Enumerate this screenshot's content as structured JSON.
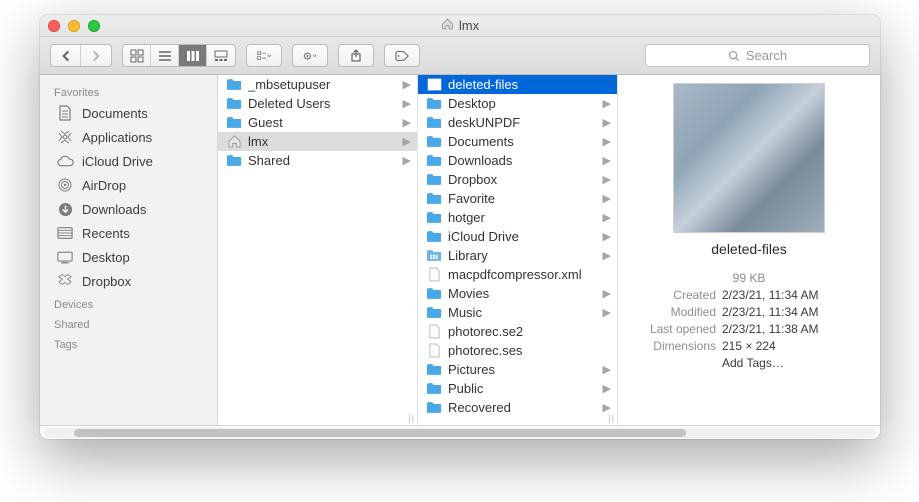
{
  "window": {
    "title": "lmx",
    "title_icon": "home-icon"
  },
  "toolbar": {
    "search_placeholder": "Search"
  },
  "sidebar": {
    "sections": [
      {
        "heading": "Favorites",
        "items": [
          {
            "icon": "documents-icon",
            "label": "Documents"
          },
          {
            "icon": "applications-icon",
            "label": "Applications"
          },
          {
            "icon": "icloud-icon",
            "label": "iCloud Drive"
          },
          {
            "icon": "airdrop-icon",
            "label": "AirDrop"
          },
          {
            "icon": "downloads-icon",
            "label": "Downloads"
          },
          {
            "icon": "recents-icon",
            "label": "Recents"
          },
          {
            "icon": "desktop-icon",
            "label": "Desktop"
          },
          {
            "icon": "dropbox-icon",
            "label": "Dropbox"
          }
        ]
      },
      {
        "heading": "Devices",
        "items": []
      },
      {
        "heading": "Shared",
        "items": []
      },
      {
        "heading": "Tags",
        "items": []
      }
    ]
  },
  "column1": [
    {
      "type": "folder",
      "label": "_mbsetupuser",
      "arrow": true
    },
    {
      "type": "folder",
      "label": "Deleted Users",
      "arrow": true
    },
    {
      "type": "folder",
      "label": "Guest",
      "arrow": true
    },
    {
      "type": "home",
      "label": "lmx",
      "arrow": true,
      "selected": "grey"
    },
    {
      "type": "folder",
      "label": "Shared",
      "arrow": true
    }
  ],
  "column2": [
    {
      "type": "image",
      "label": "deleted-files",
      "arrow": false,
      "selected": "blue"
    },
    {
      "type": "folder",
      "label": "Desktop",
      "arrow": true
    },
    {
      "type": "folder",
      "label": "deskUNPDF",
      "arrow": true
    },
    {
      "type": "folder",
      "label": "Documents",
      "arrow": true
    },
    {
      "type": "folder",
      "label": "Downloads",
      "arrow": true
    },
    {
      "type": "folder",
      "label": "Dropbox",
      "arrow": true
    },
    {
      "type": "folder",
      "label": "Favorite",
      "arrow": true
    },
    {
      "type": "folder",
      "label": "hotger",
      "arrow": true
    },
    {
      "type": "folder",
      "label": "iCloud Drive",
      "arrow": true
    },
    {
      "type": "library",
      "label": "Library",
      "arrow": true
    },
    {
      "type": "file",
      "label": "macpdfcompressor.xml",
      "arrow": false
    },
    {
      "type": "folder",
      "label": "Movies",
      "arrow": true
    },
    {
      "type": "folder",
      "label": "Music",
      "arrow": true
    },
    {
      "type": "file",
      "label": "photorec.se2",
      "arrow": false
    },
    {
      "type": "file",
      "label": "photorec.ses",
      "arrow": false
    },
    {
      "type": "folder",
      "label": "Pictures",
      "arrow": true
    },
    {
      "type": "folder",
      "label": "Public",
      "arrow": true
    },
    {
      "type": "folder",
      "label": "Recovered",
      "arrow": true
    }
  ],
  "preview": {
    "name": "deleted-files",
    "size": "99 KB",
    "meta": [
      {
        "k": "Created",
        "v": "2/23/21, 11:34 AM"
      },
      {
        "k": "Modified",
        "v": "2/23/21, 11:34 AM"
      },
      {
        "k": "Last opened",
        "v": "2/23/21, 11:38 AM"
      },
      {
        "k": "Dimensions",
        "v": "215 × 224"
      }
    ],
    "add_tags": "Add Tags…"
  }
}
